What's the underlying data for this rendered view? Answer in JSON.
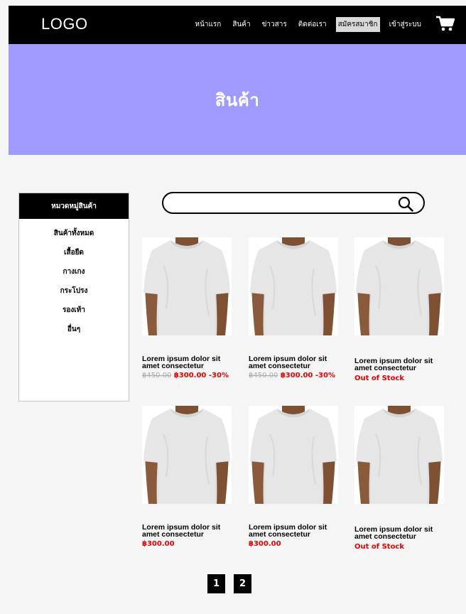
{
  "header": {
    "logo": "LOGO",
    "nav": [
      "หน้าแรก",
      "สินค้า",
      "ข่าวสาร",
      "ติดต่อเรา",
      "สมัครสมาชิก",
      "เข้าสู่ระบบ"
    ]
  },
  "banner": {
    "title": "สินค้า"
  },
  "sidebar": {
    "title": "หมวดหมู่สินค้า",
    "items": [
      "สินค้าทั้งหมด",
      "เสื้อยืด",
      "กางเกง",
      "กระโปรง",
      "รองเท้า",
      "อื่นๆ"
    ]
  },
  "search": {
    "placeholder": ""
  },
  "products": [
    {
      "name": "Lorem ipsum dolor sit amet consectetur",
      "old_price": "฿450.00",
      "price": "฿300.00",
      "discount": "-30%",
      "status": ""
    },
    {
      "name": "Lorem ipsum dolor sit amet consectetur",
      "old_price": "฿450.00",
      "price": "฿300.00",
      "discount": "-30%",
      "status": ""
    },
    {
      "name": "Lorem ipsum dolor sit amet consectetur",
      "old_price": "",
      "price": "",
      "discount": "",
      "status": "Out of Stock"
    },
    {
      "name": "Lorem ipsum dolor sit amet consectetur",
      "old_price": "",
      "price": "฿300.00",
      "discount": "",
      "status": ""
    },
    {
      "name": "Lorem ipsum dolor sit amet consectetur",
      "old_price": "",
      "price": "฿300.00",
      "discount": "",
      "status": ""
    },
    {
      "name": "Lorem ipsum dolor sit amet consectetur",
      "old_price": "",
      "price": "",
      "discount": "",
      "status": "Out of Stock"
    }
  ],
  "pagination": [
    "1",
    "2"
  ],
  "colors": {
    "banner": "#a09bff",
    "header": "#000000",
    "sale": "#e60000"
  }
}
